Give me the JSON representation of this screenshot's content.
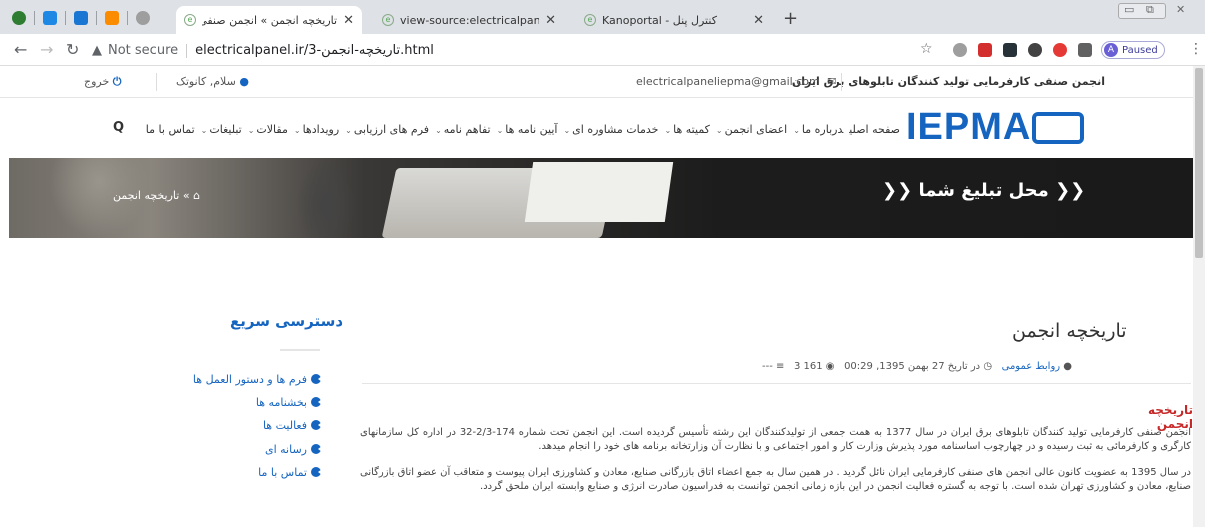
{
  "browser": {
    "tabs": [
      {
        "title": "تاریخچه انجمن » انجمن صنفی کارفرمایی تو",
        "active": true
      },
      {
        "title": "view-source:electricalpanel.ir",
        "active": false
      },
      {
        "title": "Kanoportal - کنترل پنل",
        "active": false
      }
    ],
    "new_tab": "+",
    "address": {
      "not_secure": "Not secure",
      "url": "electricalpanel.ir/3-تاریخچه-انجمن.html"
    },
    "profile_status": "Paused",
    "profile_initial": "A"
  },
  "site": {
    "topbar": {
      "association_name": "انجمن صنفی کارفرمایی تولید کنندگان تابلوهای برق ایران",
      "email": "electricalpaneliepma@gmail.com",
      "greeting": "سلام, کانوتک",
      "logout": "خروج"
    },
    "logo_text": "IEPMA",
    "menu": [
      "صفحه اصلی",
      "درباره ما",
      "اعضای انجمن",
      "کمیته ها",
      "خدمات مشاوره ای",
      "آیین نامه ها",
      "تفاهم نامه",
      "فرم های ارزیابی",
      "رویدادها",
      "مقالات",
      "تبلیغات",
      "تماس با ما"
    ],
    "menu_has_dropdown": [
      false,
      true,
      true,
      true,
      true,
      true,
      true,
      true,
      true,
      true,
      true,
      false
    ],
    "banner": {
      "breadcrumb": "» تاریخچه انجمن",
      "ad_space": "محل تبلیغ شما"
    },
    "sidebar": {
      "title": "دسترسی سریع",
      "items": [
        "فرم ها و دستور العمل ها",
        "بخشنامه ها",
        "فعالیت ها",
        "رسانه ای",
        "تماس با ما"
      ]
    },
    "article": {
      "title": "تاریخچه انجمن",
      "meta": {
        "author": "روابط عمومی",
        "date": "در تاریخ 27 بهمن 1395, 00:29",
        "views": "161 3"
      },
      "subheading": "تاریخچه انجمن",
      "paragraphs": [
        "انجمن صنفی کارفرمایی تولید کنندگان تابلوهای برق ایران در سال 1377 به همت جمعی از تولیدکنندگان این رشته تأسیس گردیده است. این انجمن تحت شماره 174-2/3-32 در اداره کل سازمانهای کارگری و کارفرمائی به ثبت رسیده و در چهارچوب اساسنامه مورد پذیرش وزارت کار و امور اجتماعی و با نظارت آن وزارتخانه برنامه های خود را انجام میدهد.",
        "در سال 1395 به عضویت کانون عالی انجمن های صنفی کارفرمایی ایران نائل گردید . در همین سال به جمع اعضاء اتاق بازرگانی صنایع، معادن و کشاورزی ایران پیوست و متعاقب آن عضو اتاق بازرگانی صنایع، معادن و کشاورزی تهران شده است. با توجه به گستره فعالیت انجمن در این بازه زمانی انجمن توانست به فدراسیون صادرت انرژی و صنایع وابسته ایران ملحق گردد."
      ]
    }
  },
  "colors": {
    "brand_blue": "#1565c0",
    "heading_red": "#c62828"
  }
}
